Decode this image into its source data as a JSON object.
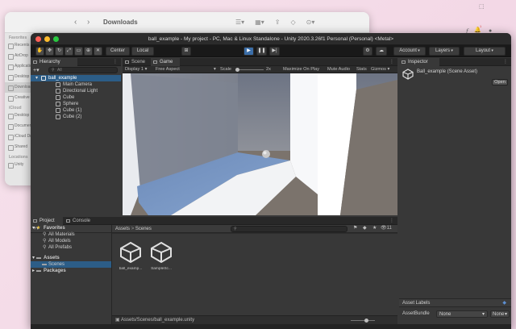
{
  "desktop": {
    "menu_glyph": "ƒ",
    "notification_count": "1"
  },
  "finder": {
    "title": "Downloads",
    "sidebar": {
      "favorites_label": "Favorites",
      "favorites": [
        "Recents",
        "AirDrop",
        "Applications",
        "Desktop",
        "Downloads",
        "Creative"
      ],
      "icloud_label": "iCloud",
      "icloud": [
        "Desktop",
        "Documents",
        "iCloud Drive",
        "Shared"
      ],
      "locations_label": "Locations",
      "locations": [
        "Unity"
      ]
    }
  },
  "unity": {
    "title": "ball_example - My project - PC, Mac & Linux Standalone - Unity 2020.3.26f1 Personal (Personal) <Metal>",
    "toolbar": {
      "center_label": "Center",
      "local_label": "Local",
      "account_label": "Account",
      "layers_label": "Layers",
      "layout_label": "Layout"
    },
    "hierarchy": {
      "tab_label": "Hierarchy",
      "search_placeholder": "All",
      "scene_name": "ball_example",
      "objects": [
        "Main Camera",
        "Directional Light",
        "Cube",
        "Sphere",
        "Cube (1)",
        "Cube (2)"
      ]
    },
    "scene_tab": "Scene",
    "game_tab": "Game",
    "game_bar": {
      "display": "Display 1",
      "aspect": "Free Aspect",
      "scale_label": "Scale",
      "scale_value": "2x",
      "maximize": "Maximize On Play",
      "mute": "Mute Audio",
      "stats": "Stats",
      "gizmos": "Gizmos"
    },
    "project": {
      "tab_project": "Project",
      "tab_console": "Console",
      "favorites_label": "Favorites",
      "favorites": [
        "All Materials",
        "All Models",
        "All Prefabs"
      ],
      "assets_label": "Assets",
      "scenes_folder": "Scenes",
      "packages_label": "Packages",
      "breadcrumb_root": "Assets",
      "breadcrumb_child": "Scenes",
      "assets": [
        "ball_examp...",
        "SampleSc..."
      ],
      "item_count": "11",
      "path": "Assets/Scenes/ball_example.unity"
    },
    "inspector": {
      "tab_label": "Inspector",
      "asset_title": "Ball_example (Scene Asset)",
      "open_label": "Open",
      "asset_labels": "Asset Labels",
      "bundle_label": "AssetBundle",
      "bundle_value": "None",
      "variant_value": "None"
    }
  }
}
